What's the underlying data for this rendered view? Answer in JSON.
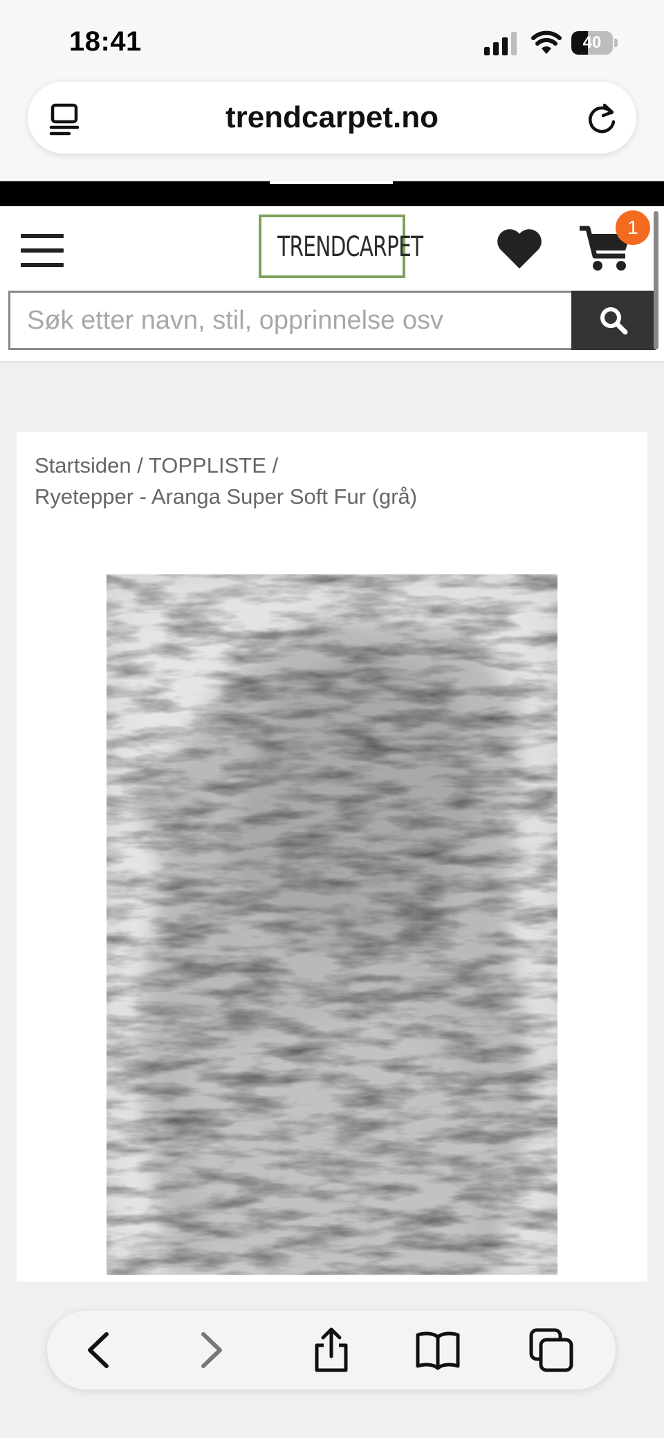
{
  "status_bar": {
    "time": "18:41",
    "battery_level": "40",
    "icons": [
      "signal-icon",
      "wifi-icon",
      "battery-icon"
    ]
  },
  "browser": {
    "url": "trendcarpet.no",
    "icons": [
      "page-menu-icon",
      "reload-icon"
    ]
  },
  "header": {
    "logo_text": "TRENDCARPET",
    "cart_count": "1",
    "icons": [
      "hamburger-icon",
      "heart-icon",
      "cart-icon",
      "search-icon"
    ],
    "search": {
      "placeholder": "Søk etter navn, stil, opprinnelse osv",
      "value": ""
    }
  },
  "breadcrumb": {
    "home": "Startsiden",
    "category": "TOPPLISTE",
    "separator": "/",
    "current": "Ryetepper - Aranga Super Soft Fur (grå)"
  },
  "product": {
    "image_alt": "product-image"
  },
  "toolbar": {
    "icons": [
      "back-icon",
      "forward-icon",
      "share-icon",
      "bookmarks-icon",
      "tabs-icon"
    ]
  },
  "colors": {
    "accent_logo": "#7da15c",
    "badge": "#f26b21",
    "search_button": "#333333",
    "promo_strip": "#000000"
  }
}
